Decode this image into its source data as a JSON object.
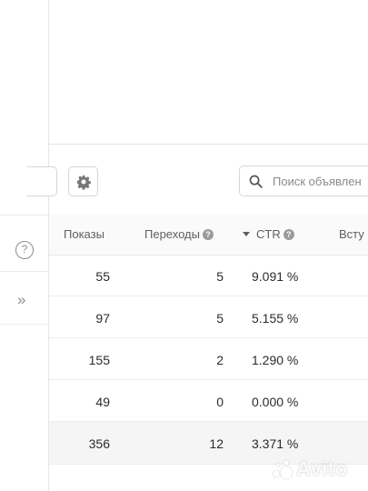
{
  "toolbar": {
    "search_placeholder": "Поиск объявлен",
    "settings_icon": "gear-icon"
  },
  "sidebar": {
    "help_glyph": "?",
    "expand_glyph": "»"
  },
  "table": {
    "headers": {
      "shows": "Показы",
      "clicks": "Переходы",
      "ctr": "CTR",
      "contacts": "Всту"
    },
    "info_glyph": "?",
    "rows": [
      {
        "shows": "55",
        "clicks": "5",
        "ctr": "9.091 %"
      },
      {
        "shows": "97",
        "clicks": "5",
        "ctr": "5.155 %"
      },
      {
        "shows": "155",
        "clicks": "2",
        "ctr": "1.290 %"
      },
      {
        "shows": "49",
        "clicks": "0",
        "ctr": "0.000 %"
      }
    ],
    "total": {
      "shows": "356",
      "clicks": "12",
      "ctr": "3.371 %"
    }
  },
  "watermark": {
    "text": "Avito"
  }
}
